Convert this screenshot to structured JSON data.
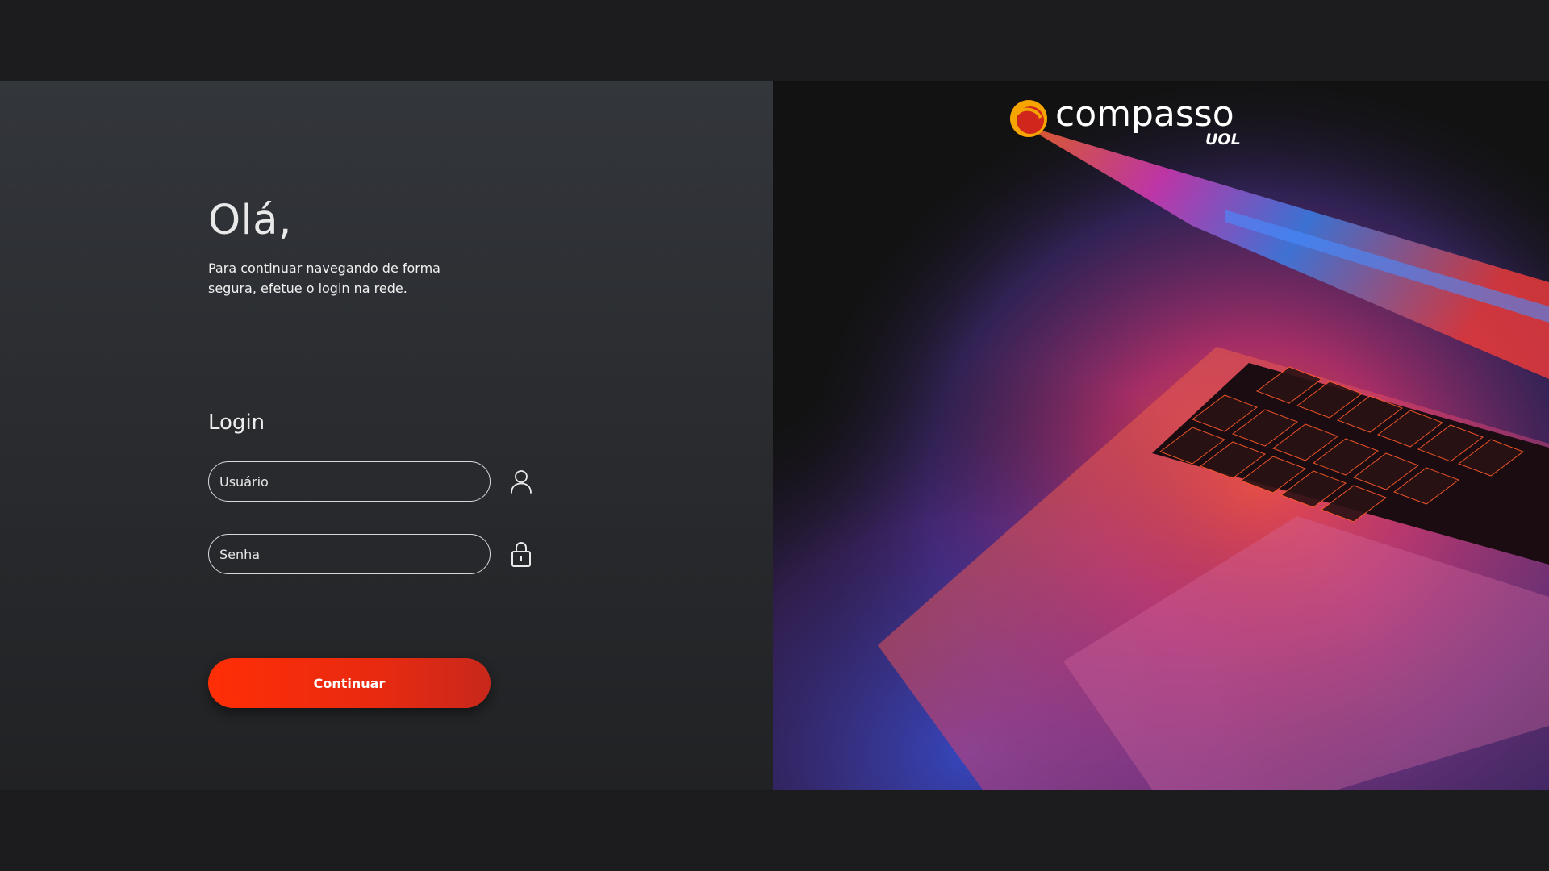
{
  "left": {
    "greeting": "Olá,",
    "subtitle": "Para continuar navegando de forma segura, efetue o login na rede.",
    "login_title": "Login",
    "username": {
      "placeholder": "Usuário",
      "value": ""
    },
    "password": {
      "placeholder": "Senha",
      "value": ""
    },
    "user_icon": "user-icon",
    "lock_icon": "lock-icon",
    "continue_label": "Continuar"
  },
  "brand": {
    "logo_word": "compasso",
    "logo_sub": "UOL",
    "accent": "#ff2e06",
    "logo_mark_colors": [
      "#f6a500",
      "#d0261c"
    ]
  },
  "colors": {
    "page_background": "#1c1c1e",
    "panel_top": "#33363b",
    "panel_bottom": "#212224",
    "button_start": "#ff2e06",
    "button_end": "#c8281c"
  }
}
